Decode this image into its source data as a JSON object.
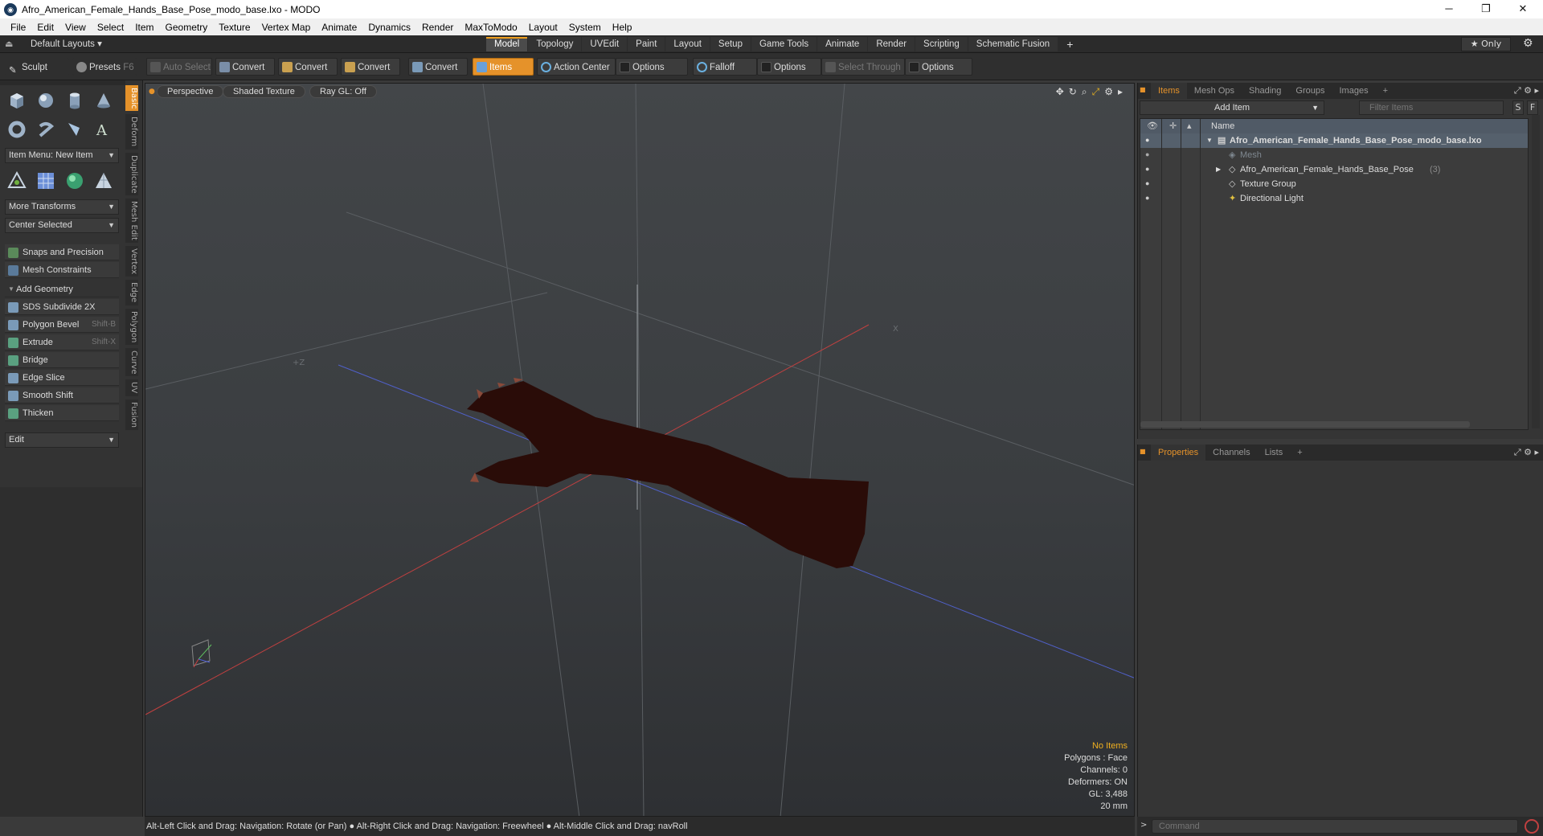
{
  "window": {
    "title": "Afro_American_Female_Hands_Base_Pose_modo_base.lxo - MODO",
    "minimize": "─",
    "restore": "❐",
    "close": "✕"
  },
  "menubar": [
    "File",
    "Edit",
    "View",
    "Select",
    "Item",
    "Geometry",
    "Texture",
    "Vertex Map",
    "Animate",
    "Dynamics",
    "Render",
    "MaxToModo",
    "Layout",
    "System",
    "Help"
  ],
  "layoutbar": {
    "layouts_label": "Default Layouts ▾",
    "tabs": [
      "Model",
      "Topology",
      "UVEdit",
      "Paint",
      "Layout",
      "Setup",
      "Game Tools",
      "Animate",
      "Render",
      "Scripting",
      "Schematic Fusion"
    ],
    "active_tab": "Model",
    "plus": "+",
    "only_label": "★ Only",
    "gear": "⚙"
  },
  "toolbar": {
    "sculpt": "Sculpt",
    "presets": "Presets",
    "presets_key": "F6",
    "auto_select": "Auto Select",
    "convert1": "Convert",
    "convert2": "Convert",
    "convert3": "Convert",
    "convert4": "Convert",
    "items": "Items",
    "action_center": "Action Center",
    "options1": "Options",
    "falloff": "Falloff",
    "options2": "Options",
    "select_through": "Select Through",
    "options3": "Options"
  },
  "leftpanel": {
    "vtabs": [
      "Basic",
      "Deform",
      "Duplicate",
      "Mesh Edit",
      "Vertex",
      "Edge",
      "Polygon",
      "Curve",
      "UV",
      "Fusion"
    ],
    "item_menu": "Item Menu: New Item",
    "more_transforms": "More Transforms",
    "center_selected": "Center Selected",
    "snaps": "Snaps and Precision",
    "mesh_constraints": "Mesh Constraints",
    "add_geometry": "Add Geometry",
    "tools": [
      {
        "label": "SDS Subdivide 2X",
        "shortcut": ""
      },
      {
        "label": "Polygon Bevel",
        "shortcut": "Shift-B"
      },
      {
        "label": "Extrude",
        "shortcut": "Shift-X"
      },
      {
        "label": "Bridge",
        "shortcut": ""
      },
      {
        "label": "Edge Slice",
        "shortcut": ""
      },
      {
        "label": "Smooth Shift",
        "shortcut": ""
      },
      {
        "label": "Thicken",
        "shortcut": ""
      }
    ],
    "edit": "Edit"
  },
  "viewport": {
    "view_mode": "Perspective",
    "shading": "Shaded Texture",
    "raygl": "Ray GL: Off",
    "axis_z_label": "+Z",
    "axis_x_label": "X",
    "info": {
      "no_items": "No Items",
      "polygons": "Polygons : Face",
      "channels": "Channels: 0",
      "deformers": "Deformers: ON",
      "gl": "GL: 3,488",
      "scale": "20 mm"
    },
    "colors": {
      "no_items": "#f0b020",
      "mesh": "#2a0c08"
    }
  },
  "statusbar": "Alt-Left Click and Drag: Navigation: Rotate (or Pan) ● Alt-Right Click and Drag: Navigation: Freewheel ● Alt-Middle Click and Drag: navRoll",
  "items_panel": {
    "tabs": [
      "Items",
      "Mesh Ops",
      "Shading",
      "Groups",
      "Images"
    ],
    "active_tab": "Items",
    "add_item": "Add Item",
    "filter_placeholder": "Filter Items",
    "btn_s": "S",
    "btn_f": "F",
    "name_header": "Name",
    "rows": [
      {
        "label": "Afro_American_Female_Hands_Base_Pose_modo_base.lxo",
        "count": ""
      },
      {
        "label": "Mesh",
        "count": ""
      },
      {
        "label": "Afro_American_Female_Hands_Base_Pose",
        "count": "(3)"
      },
      {
        "label": "Texture Group",
        "count": ""
      },
      {
        "label": "Directional Light",
        "count": ""
      }
    ]
  },
  "props_panel": {
    "tabs": [
      "Properties",
      "Channels",
      "Lists"
    ],
    "active_tab": "Properties",
    "plus": "+"
  },
  "command": {
    "placeholder": "Command"
  }
}
